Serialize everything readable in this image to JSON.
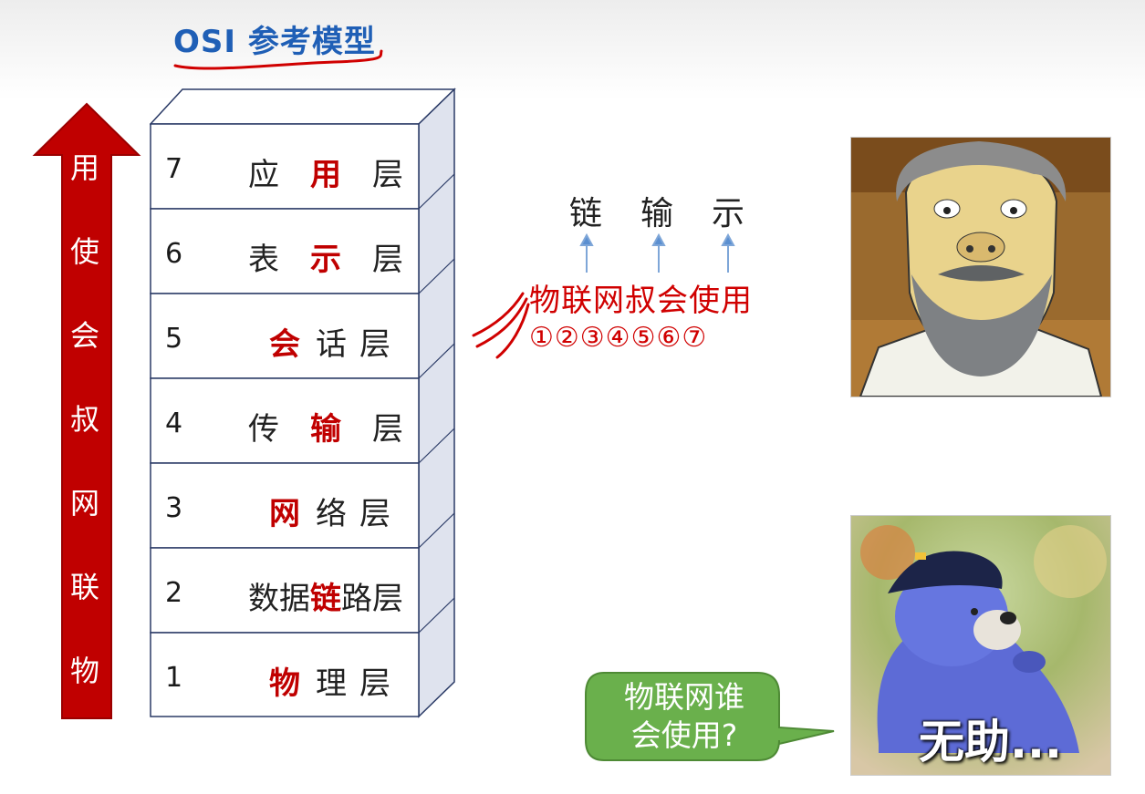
{
  "title": "OSI 参考模型",
  "arrow": {
    "chars": [
      "用",
      "使",
      "会",
      "叔",
      "网",
      "联",
      "物"
    ],
    "color": "#c00000"
  },
  "layers": [
    {
      "num": "7",
      "pre": "应",
      "key": "用",
      "post": "层"
    },
    {
      "num": "6",
      "pre": "表",
      "key": "示",
      "post": "层"
    },
    {
      "num": "5",
      "pre": "",
      "key": "会",
      "post": "话层"
    },
    {
      "num": "4",
      "pre": "传",
      "key": "输",
      "post": "层"
    },
    {
      "num": "3",
      "pre": "",
      "key": "网",
      "post": "络层"
    },
    {
      "num": "2",
      "pre": "数据",
      "key": "链",
      "post": "路层"
    },
    {
      "num": "1",
      "pre": "",
      "key": "物",
      "post": "理层"
    }
  ],
  "mnemonic": {
    "top": [
      "链",
      "输",
      "示"
    ],
    "phrase": "物联网叔会使用",
    "numbers": "①②③④⑤⑥⑦"
  },
  "bubble": {
    "line1": "物联网谁",
    "line2": "会使用?"
  },
  "mole_caption": "无助...",
  "colors": {
    "title": "#1f5fb6",
    "key": "#c00000",
    "bubble": "#6ab04c"
  },
  "images": {
    "grandpa": "cartoon-grandpa-image",
    "mole": "plush-mole-image"
  }
}
